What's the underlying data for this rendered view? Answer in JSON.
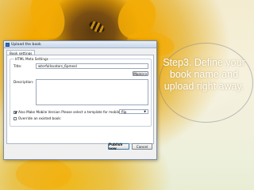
{
  "dialog": {
    "title": "Upload the book",
    "tab": "Book settings",
    "group_title": "HTML Meta Settings",
    "title_label": "Title:",
    "title_value": "wterfallsvators_6pmeel",
    "description_label": "Description:",
    "description_value": "",
    "more_button": "More>>",
    "mobile_checkbox_label": "Also Make Mobile Version Please select a template for mobile:",
    "mobile_checked": true,
    "template_select": "flip",
    "override_checkbox_label": "Override an existed book:",
    "override_checked": false,
    "publish_button": "Publish now",
    "cancel_button": "Cancel"
  },
  "callout": {
    "text": "Step3. Define your book name and upload right away."
  },
  "colors": {
    "callout_text": "#ffffff",
    "dialog_bg": "#f0f0f0",
    "sunflower": "#f3ac05"
  }
}
